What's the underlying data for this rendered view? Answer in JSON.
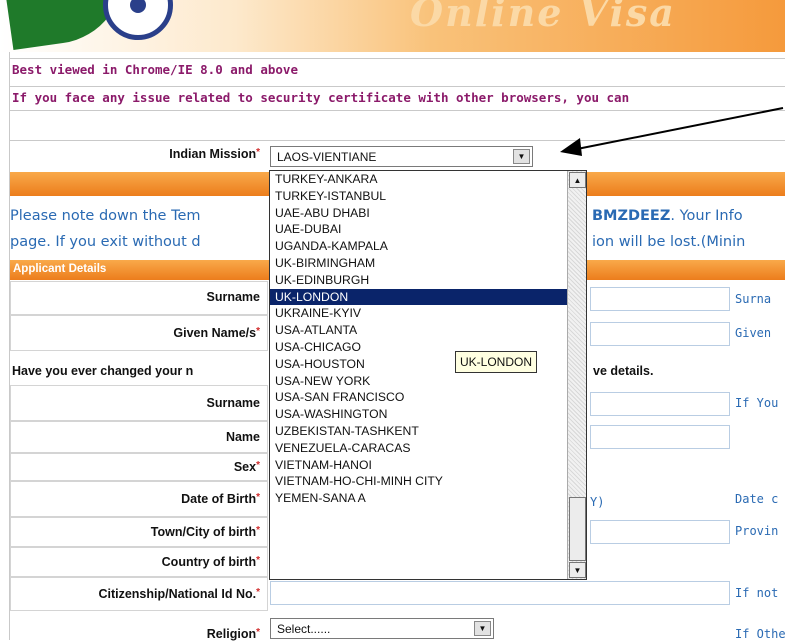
{
  "banner": {
    "title_fragment": "Online Visa"
  },
  "info": {
    "browser_note": "Best viewed in Chrome/IE 8.0 and above",
    "cert_note": "If you face any issue related to security certificate with other browsers, you can"
  },
  "mission": {
    "label": "Indian Mission",
    "selected": "LAOS-VIENTIANE",
    "arrow_char": "▼"
  },
  "dropdown": {
    "options": [
      "TURKEY-ANKARA",
      "TURKEY-ISTANBUL",
      "UAE-ABU DHABI",
      "UAE-DUBAI",
      "UGANDA-KAMPALA",
      "UK-BIRMINGHAM",
      "UK-EDINBURGH",
      "UK-LONDON",
      "UKRAINE-KYIV",
      "USA-ATLANTA",
      "USA-CHICAGO",
      "USA-HOUSTON",
      "USA-NEW YORK",
      "USA-SAN FRANCISCO",
      "USA-WASHINGTON",
      "UZBEKISTAN-TASHKENT",
      "VENEZUELA-CARACAS",
      "VIETNAM-HANOI",
      "VIETNAM-HO-CHI-MINH CITY",
      "YEMEN-SANA A"
    ],
    "highlighted": "UK-LONDON",
    "tooltip": "UK-LONDON"
  },
  "notice": {
    "line1_left": "Please note down the Tem",
    "line1_code": "BMZDEEZ",
    "line1_right": ". Your Info",
    "line2_left": "page. If you exit without d",
    "line2_right": "ion will be lost.(Minin"
  },
  "section": {
    "title": "Applicant Details"
  },
  "form": {
    "surname": "Surname",
    "given_name": "Given Name/s",
    "changed_name": "Have you ever changed your n",
    "changed_name_right": "ve details.",
    "prev_surname": "Surname",
    "prev_name": "Name",
    "sex": "Sex",
    "dob": "Date of Birth",
    "dob_hint": "Y)",
    "town": "Town/City of birth",
    "country": "Country of birth",
    "citizenship": "Citizenship/National Id No.",
    "religion": "Religion",
    "religion_select": "Select......"
  },
  "helpers": {
    "surname": "Surna",
    "given": "Given",
    "prev": "If You",
    "dob": "Date c",
    "town": "Provin",
    "citizen": "If not",
    "religion": "If Othe"
  },
  "colors": {
    "accent_orange": "#ec7d1c",
    "info_purple": "#8b1a6a",
    "link_blue": "#2a6ab3",
    "highlight_navy": "#0a246a"
  }
}
